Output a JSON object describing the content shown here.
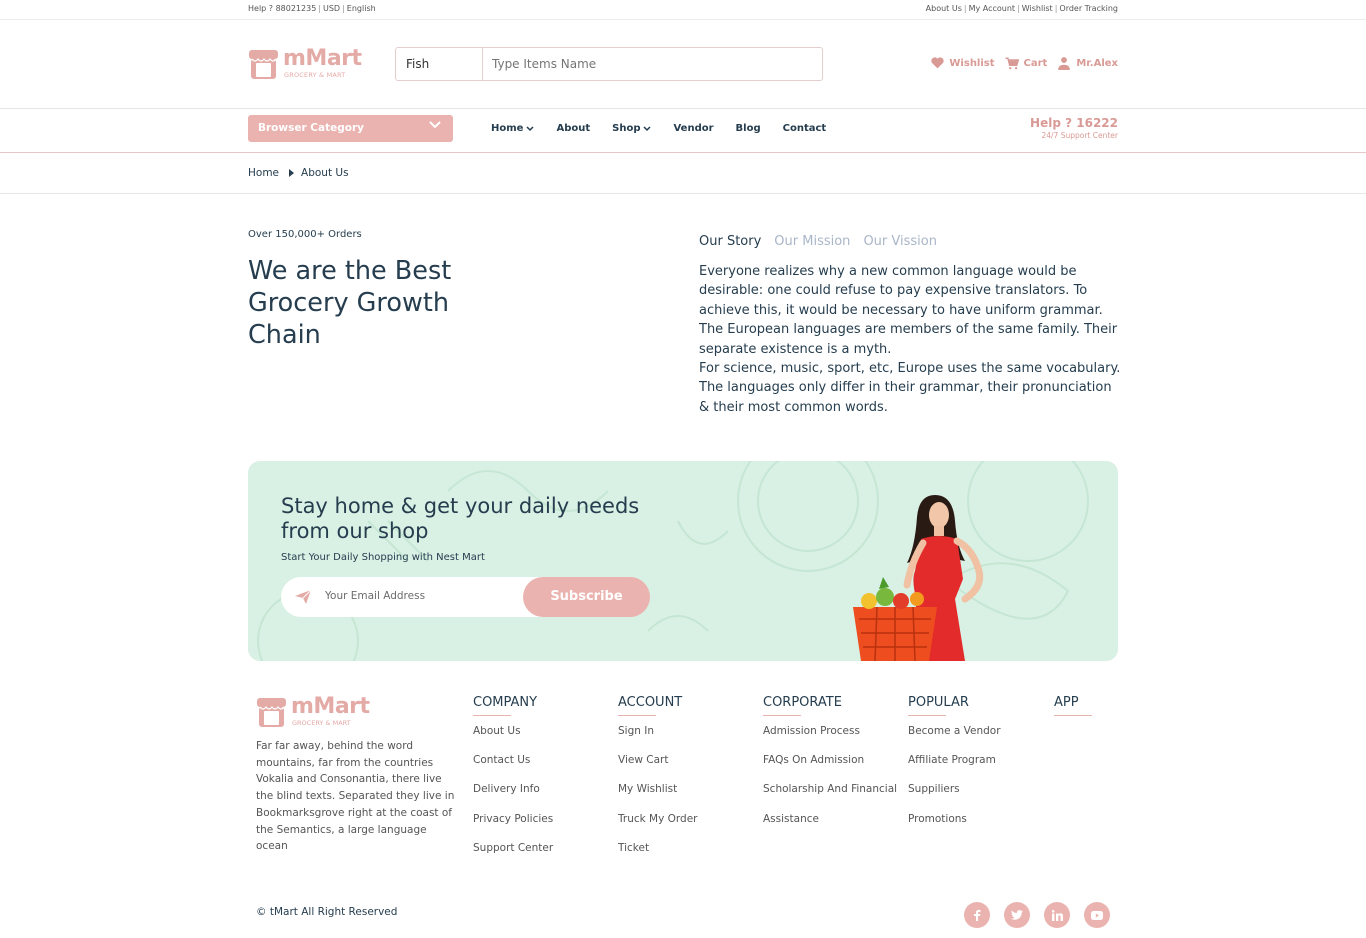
{
  "topbar": {
    "help": "Help ? 88021235",
    "currency": "USD",
    "language": "English",
    "links": [
      "About Us",
      "My Account",
      "Wishlist",
      "Order Tracking"
    ]
  },
  "brand": {
    "name": "mMart",
    "tagline": "GROCERY & MART",
    "color": "#e3aaa6"
  },
  "search": {
    "category": "Fish",
    "placeholder": "Type Items Name"
  },
  "header_actions": {
    "wishlist": "Wishlist",
    "cart": "Cart",
    "user": "Mr.Alex"
  },
  "nav": {
    "browse_label": "Browser Category",
    "items": [
      "Home",
      "About",
      "Shop",
      "Vendor",
      "Blog",
      "Contact"
    ],
    "help_number": "Help ? 16222",
    "help_sub": "24/7 Support Center"
  },
  "breadcrumb": {
    "home": "Home",
    "current": "About Us"
  },
  "about": {
    "orders": "Over 150,000+ Orders",
    "headline": "We are the Best Grocery Growth Chain",
    "tabs": [
      "Our Story",
      "Our Mission",
      "Our Vission"
    ],
    "active_tab": "Our Story",
    "story_p1": "Everyone realizes why a new common language would be desirable: one could refuse to pay expensive translators. To achieve this, it would be necessary to have uniform grammar. The European languages are members of the same family. Their separate existence is a myth.",
    "story_p2": "For science, music, sport, etc, Europe uses the same vocabulary. The languages only differ in their grammar, their pronunciation & their most common words."
  },
  "newsletter": {
    "title": "Stay home & get your daily needs from our shop",
    "subtitle": "Start Your Daily Shopping with Nest Mart",
    "placeholder": "Your Email Address",
    "button": "Subscribe",
    "bg_color": "#d9f0e4"
  },
  "footer": {
    "description": "Far far away, behind the word mountains, far from the countries Vokalia and Consonantia, there live the blind texts. Separated they live in Bookmarksgrove right at the coast of the Semantics, a large language ocean",
    "columns": [
      {
        "title": "COMPANY",
        "links": [
          "About Us",
          "Contact Us",
          "Delivery Info",
          "Privacy Policies",
          "Support Center"
        ]
      },
      {
        "title": "ACCOUNT",
        "links": [
          "Sign In",
          "View Cart",
          "My Wishlist",
          "Truck My Order",
          "Ticket"
        ]
      },
      {
        "title": "CORPORATE",
        "links": [
          "Admission Process",
          "FAQs On Admission",
          "Scholarship And Financial",
          "Assistance"
        ]
      },
      {
        "title": "POPULAR",
        "links": [
          "Become a Vendor",
          "Affiliate Program",
          "Suppiliers",
          "Promotions"
        ]
      },
      {
        "title": "APP",
        "links": []
      }
    ],
    "copyright": "© tMart All Right Reserved",
    "social": [
      "facebook-icon",
      "twitter-icon",
      "linkedin-icon",
      "youtube-icon"
    ]
  },
  "accent_color": "#ebb3af"
}
